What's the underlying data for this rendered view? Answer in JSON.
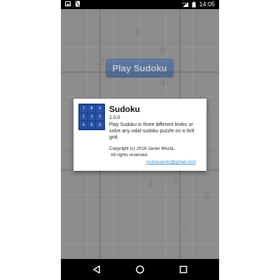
{
  "status_bar": {
    "time": "14:05",
    "left_icons": [
      "image-icon",
      "notification-icon"
    ],
    "right_icons": [
      "lte-signal-icon",
      "battery-icon"
    ]
  },
  "background": {
    "play_button_label": "Play Sudoku",
    "grid_digits": [
      "5",
      "8",
      "4",
      "2",
      "7",
      "6",
      "3",
      "1",
      "9",
      "7",
      "8",
      "2"
    ]
  },
  "dialog": {
    "app_name": "Sudoku",
    "version": "1.0.0",
    "description": "Play Sudoku in three different levles or solve any valid sudoku puzzle on a 9x9 grid.",
    "copyright": "Copyright (c) 2016 Javier Mucia.",
    "rights": "All rights reserved.",
    "email": "mucia.javier@gmail.com",
    "icon_digits": [
      "7",
      "8",
      "9",
      "1",
      "2",
      "3",
      "4",
      "5",
      "6"
    ]
  },
  "nav_bar": {
    "buttons": [
      "back-icon",
      "home-icon",
      "recents-icon"
    ]
  }
}
